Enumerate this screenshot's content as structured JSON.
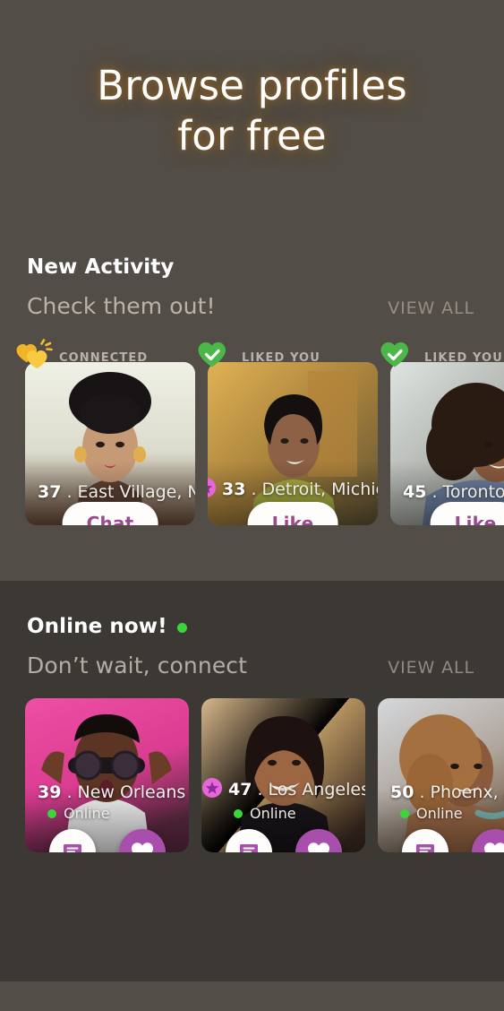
{
  "hero": {
    "title_line1": "Browse profiles",
    "title_line2": "for free",
    "glow_color": "#8c6028"
  },
  "activity": {
    "title": "New Activity",
    "subtitle": "Check them out!",
    "view_all": "VIEW ALL",
    "cards": [
      {
        "badge_label": "CONNECTED",
        "badge_icon": "two-hearts-sparkle-icon",
        "badge_color": "#f5bb33",
        "age": "37",
        "separator": ".",
        "location": "East Village, NY",
        "action_label": "Chat",
        "has_star": false,
        "photo_bg_top": "#eceee0",
        "photo_bg_bottom": "#6d4f3e"
      },
      {
        "badge_label": "LIKED YOU",
        "badge_icon": "heart-check-icon",
        "badge_color": "#4cb749",
        "age": "33",
        "separator": ".",
        "location": "Detroit, Michigan",
        "action_label": "Like",
        "has_star": true,
        "star_color": "#e667d8",
        "photo_bg_top": "#c99a3e",
        "photo_bg_bottom": "#7c6a3c"
      },
      {
        "badge_label": "LIKED YOU",
        "badge_icon": "heart-check-icon",
        "badge_color": "#4cb749",
        "age": "45",
        "separator": ".",
        "location": "Toronto,Ca",
        "action_label": "Like",
        "has_star": false,
        "photo_bg_top": "#cfd6d3",
        "photo_bg_bottom": "#6b5b4c"
      }
    ]
  },
  "online": {
    "title": "Online now!",
    "status_dot_color": "#3ad63a",
    "subtitle": "Don’t wait, connect",
    "view_all": "VIEW ALL",
    "cards": [
      {
        "age": "39",
        "separator": ".",
        "location": "New Orleans",
        "status": "Online",
        "has_star": false,
        "chat_icon": "chat-bubble-icon",
        "like_icon": "heart-icon",
        "photo_bg_top": "#e4489b",
        "photo_bg_bottom": "#5a2b3f"
      },
      {
        "age": "47",
        "separator": ".",
        "location": "Los Angeles, CA",
        "status": "Online",
        "has_star": true,
        "star_color": "#e667d8",
        "chat_icon": "chat-bubble-icon",
        "like_icon": "heart-icon",
        "photo_bg_top": "#c9a478",
        "photo_bg_bottom": "#3a2a22"
      },
      {
        "age": "50",
        "separator": ".",
        "location": "Phoenx, A",
        "status": "Online",
        "has_star": false,
        "chat_icon": "chat-bubble-icon",
        "like_icon": "heart-icon",
        "photo_bg_top": "#cfd2d6",
        "photo_bg_bottom": "#7a5c48"
      }
    ]
  },
  "theme": {
    "bg_top": "#524d46",
    "bg_bottom_section": "#3c3934",
    "accent_purple": "#a84fae",
    "button_text_purple": "#9a4a90"
  }
}
